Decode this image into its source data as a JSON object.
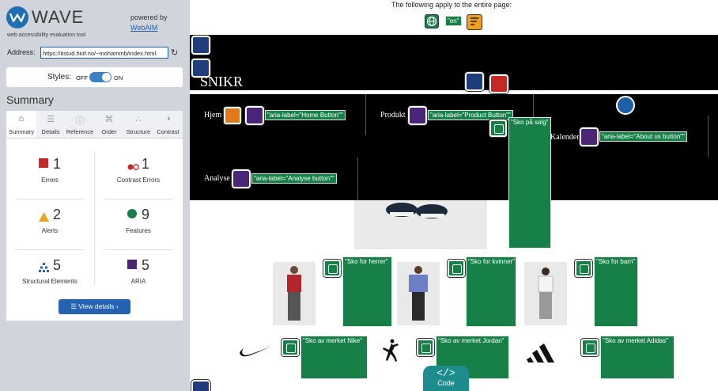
{
  "wave": {
    "title": "WAVE",
    "subtitle": "web accessibility evaluation tool",
    "powered_by": "powered by",
    "webaim": "WebAIM",
    "address_label": "Address:",
    "address_value": "https://itstud.hiof.no/~mohammb/index.html",
    "styles_label": "Styles:",
    "styles_off": "OFF",
    "styles_on": "ON",
    "summary_title": "Summary",
    "tabs": [
      {
        "label": "Summary",
        "icon": "home-icon"
      },
      {
        "label": "Details",
        "icon": "list-icon"
      },
      {
        "label": "Reference",
        "icon": "info-icon"
      },
      {
        "label": "Order",
        "icon": "order-icon"
      },
      {
        "label": "Structure",
        "icon": "structure-icon"
      },
      {
        "label": "Contrast",
        "icon": "contrast-icon"
      }
    ],
    "stats": {
      "errors": {
        "value": "1",
        "label": "Errors"
      },
      "contrast_errors": {
        "value": "1",
        "label": "Contrast Errors"
      },
      "alerts": {
        "value": "2",
        "label": "Alerts"
      },
      "features": {
        "value": "9",
        "label": "Features"
      },
      "structural": {
        "value": "5",
        "label": "Structural Elements"
      },
      "aria": {
        "value": "5",
        "label": "ARIA"
      }
    },
    "view_details": "View details ›",
    "colors": {
      "accent": "#2563b0",
      "error": "#c62828",
      "alert": "#f0a020",
      "feature": "#178049",
      "aria": "#4b2577"
    }
  },
  "page": {
    "note": "The following apply to the entire page:",
    "lang_label": "\"en\"",
    "logo": "SNIKR",
    "nav": {
      "home": "Hjem",
      "home_aria": "\"aria-label=\"Home Button\"\"",
      "product": "Produkt",
      "product_aria": "\"aria-label=\"Product Button\"\"",
      "calendar": "Kalender",
      "calendar_aria": "\"aria-label=\"About us button\"\"",
      "analyse": "Analyse",
      "analyse_aria": "\"aria-label=\"Analyse button\"\""
    },
    "hero_alt": "\"Sko på salg\"",
    "categories": [
      {
        "alt": "\"Sko for herrer\""
      },
      {
        "alt": "\"Sko for kvinner\""
      },
      {
        "alt": "\"Sko for barn\""
      }
    ],
    "brands": [
      {
        "alt": "\"Sko av merket Nike\""
      },
      {
        "alt": "\"Sko av merket Jordan\""
      },
      {
        "alt": "\"Sko av merket Adidas\""
      }
    ],
    "code_button": "Code",
    "code_glyph": "</>"
  }
}
